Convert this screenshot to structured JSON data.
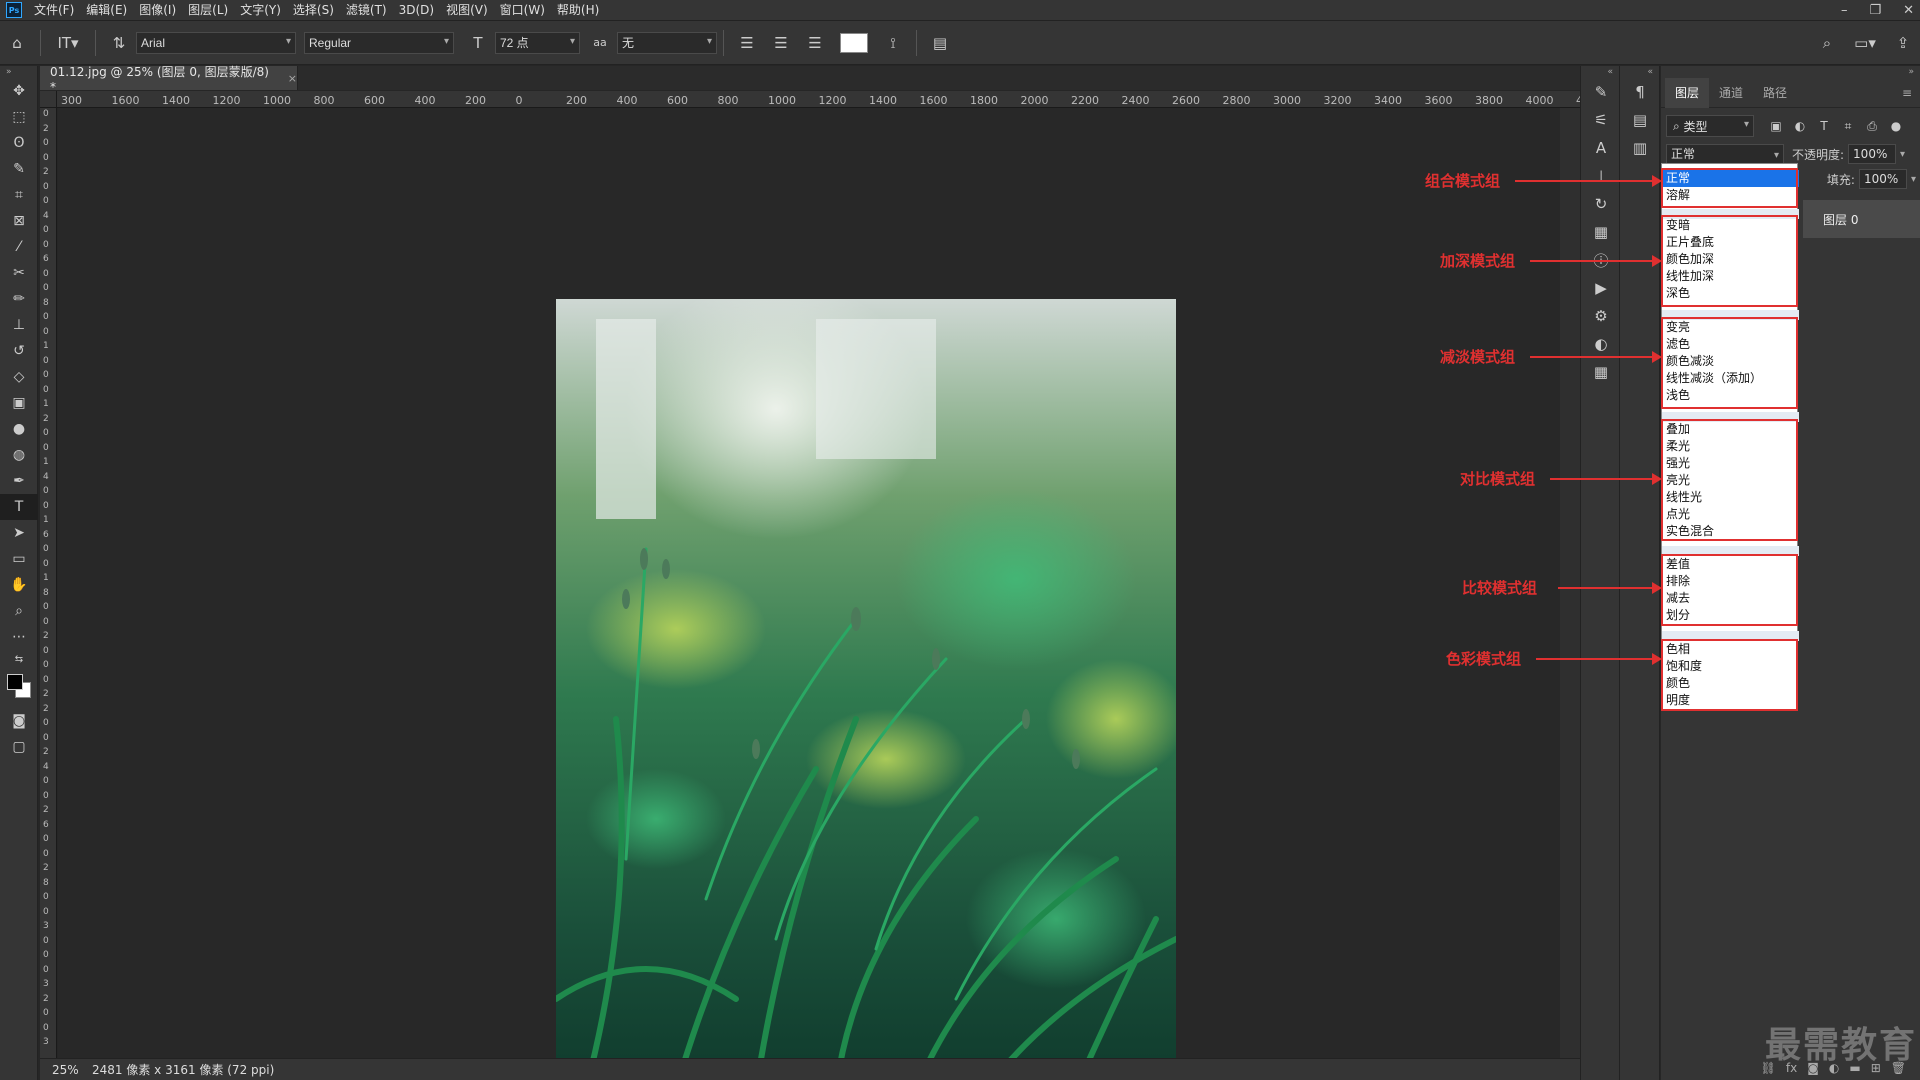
{
  "menu": {
    "logo": "Ps",
    "items": [
      "文件(F)",
      "编辑(E)",
      "图像(I)",
      "图层(L)",
      "文字(Y)",
      "选择(S)",
      "滤镜(T)",
      "3D(D)",
      "视图(V)",
      "窗口(W)",
      "帮助(H)"
    ],
    "window_controls": [
      "minimize-icon",
      "restore-icon",
      "close-icon"
    ]
  },
  "options": {
    "font_family": "Arial",
    "font_style": "Regular",
    "font_size": "72 点",
    "antialias_symbol": "aa",
    "antialias": "无",
    "text_color": "#ffffff"
  },
  "document": {
    "tab_title": "01.12.jpg @ 25% (图层 0, 图层蒙版/8) *",
    "tab_close": "×",
    "zoom": "25%",
    "info": "2481 像素 x 3161 像素 (72 ppi)"
  },
  "rulers": {
    "top": [
      "300",
      "1600",
      "1400",
      "1200",
      "1000",
      "800",
      "600",
      "400",
      "200",
      "0",
      "200",
      "400",
      "600",
      "800",
      "1000",
      "1200",
      "1400",
      "1600",
      "1800",
      "2000",
      "2200",
      "2400",
      "2600",
      "2800",
      "3000",
      "3200",
      "3400",
      "3600",
      "3800",
      "4000",
      "4"
    ],
    "left": [
      "0",
      "2",
      "0",
      "0",
      "2",
      "0",
      "0",
      "4",
      "0",
      "0",
      "6",
      "0",
      "0",
      "8",
      "0",
      "0",
      "1",
      "0",
      "0",
      "0",
      "1",
      "2",
      "0",
      "0",
      "1",
      "4",
      "0",
      "0",
      "1",
      "6",
      "0",
      "0",
      "1",
      "8",
      "0",
      "0",
      "2",
      "0",
      "0",
      "0",
      "2",
      "2",
      "0",
      "0",
      "2",
      "4",
      "0",
      "0",
      "2",
      "6",
      "0",
      "0",
      "2",
      "8",
      "0",
      "0",
      "3",
      "0",
      "0",
      "0",
      "3",
      "2",
      "0",
      "0",
      "3"
    ]
  },
  "layers_panel": {
    "tabs": [
      "图层",
      "通道",
      "路径"
    ],
    "active_tab": "图层",
    "filter": "类型",
    "blend_mode": "正常",
    "opacity_label": "不透明度:",
    "opacity": "100%",
    "fill_label": "填充:",
    "fill": "100%",
    "layer_name": "图层 0",
    "watermark": "最需教育",
    "footer_icons": [
      "link-icon",
      "fx-icon",
      "mask-icon",
      "adjustment-icon",
      "group-icon",
      "new-layer-icon",
      "trash-icon"
    ],
    "footer_fx": "fx"
  },
  "blend_groups": [
    {
      "label": "组合模式组",
      "items": [
        "正常",
        "溶解"
      ]
    },
    {
      "label": "加深模式组",
      "items": [
        "变暗",
        "正片叠底",
        "颜色加深",
        "线性加深",
        "深色"
      ]
    },
    {
      "label": "减淡模式组",
      "items": [
        "变亮",
        "滤色",
        "颜色减淡",
        "线性减淡（添加）",
        "浅色"
      ]
    },
    {
      "label": "对比模式组",
      "items": [
        "叠加",
        "柔光",
        "强光",
        "亮光",
        "线性光",
        "点光",
        "实色混合"
      ]
    },
    {
      "label": "比较模式组",
      "items": [
        "差值",
        "排除",
        "减去",
        "划分"
      ]
    },
    {
      "label": "色彩模式组",
      "items": [
        "色相",
        "饱和度",
        "颜色",
        "明度"
      ]
    }
  ],
  "colors": {
    "annotation": "#e03030",
    "selection": "#1a73e8",
    "canvas": "#282828"
  }
}
